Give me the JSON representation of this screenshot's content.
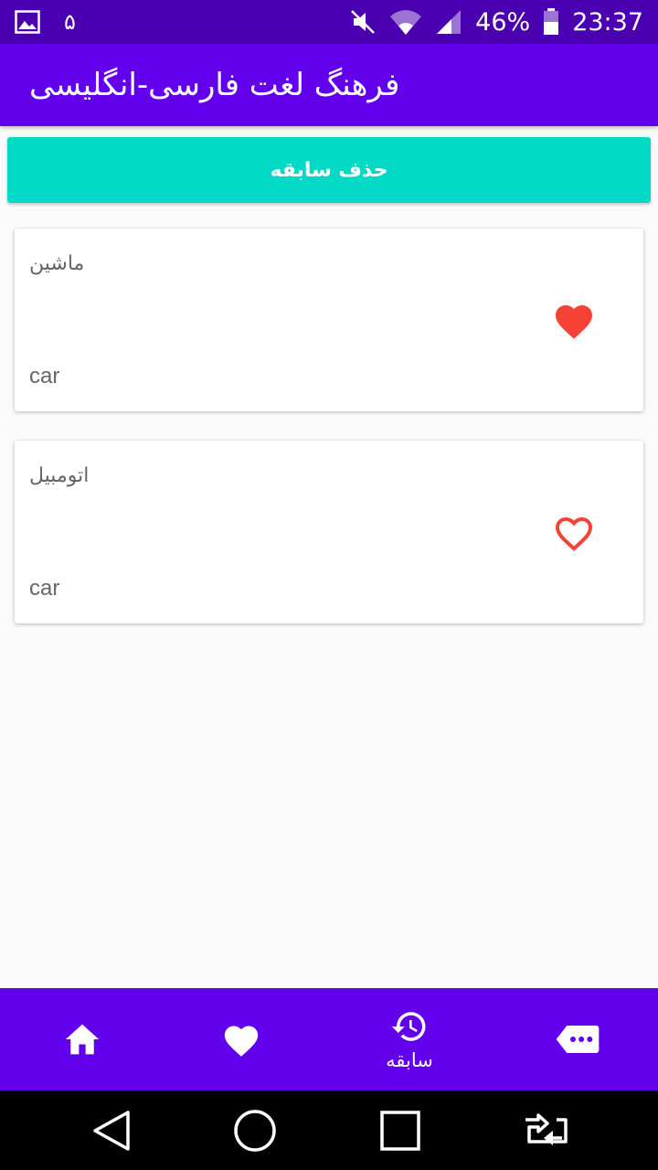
{
  "status_bar": {
    "notification_count": "۵",
    "battery": "46%",
    "time": "23:37",
    "icons": [
      "gallery-icon",
      "mute-icon",
      "wifi-icon",
      "signal-icon",
      "battery-icon"
    ]
  },
  "app_bar": {
    "title": "فرهنگ لغت فارسی-انگلیسی"
  },
  "clear_button": {
    "label": "حذف سابقه"
  },
  "history": [
    {
      "persian": "ماشین",
      "english": "car",
      "favorite": true
    },
    {
      "persian": "اتومبیل",
      "english": "car",
      "favorite": false
    }
  ],
  "bottom_nav": {
    "items": [
      {
        "icon": "home-icon",
        "label": ""
      },
      {
        "icon": "heart-icon",
        "label": ""
      },
      {
        "icon": "history-icon",
        "label": "سابقه"
      },
      {
        "icon": "more-icon",
        "label": ""
      }
    ]
  },
  "colors": {
    "status_bar": "#4a00b0",
    "primary": "#6200ee",
    "accent": "#03dac5",
    "heart": "#f44336"
  }
}
